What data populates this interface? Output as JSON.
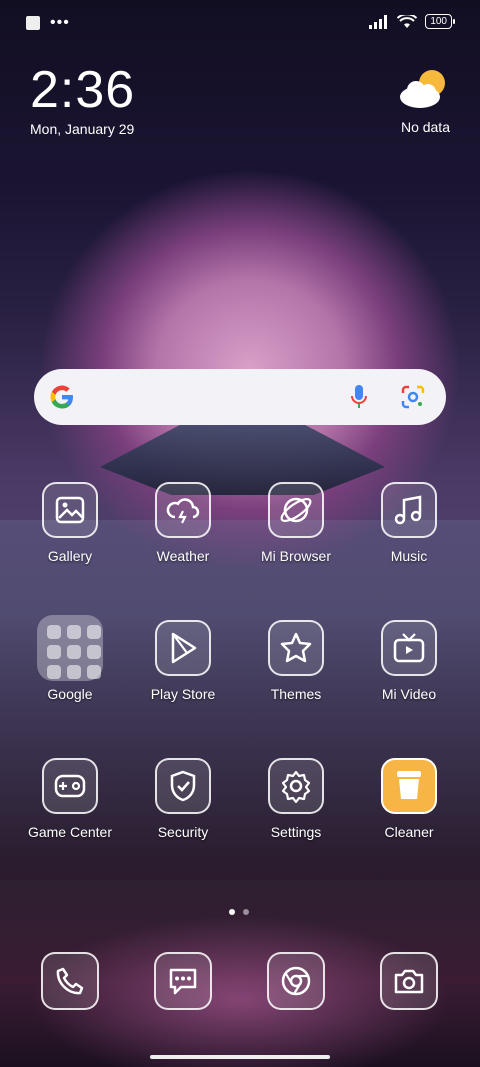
{
  "status_bar": {
    "battery": "100"
  },
  "clock": {
    "time": "2:36",
    "date": "Mon, January 29"
  },
  "weather_widget": {
    "text": "No data"
  },
  "search": {
    "mic_icon": "mic-icon",
    "lens_icon": "lens-icon"
  },
  "apps": {
    "row1": [
      "Gallery",
      "Weather",
      "Mi Browser",
      "Music"
    ],
    "row2": [
      "Google",
      "Play Store",
      "Themes",
      "Mi Video"
    ],
    "row3": [
      "Game Center",
      "Security",
      "Settings",
      "Cleaner"
    ]
  },
  "dock": [
    "phone-icon",
    "messages-icon",
    "chrome-icon",
    "camera-icon"
  ],
  "colors": {
    "accent": "#f6b545",
    "search_bg": "#f3f2f7"
  }
}
